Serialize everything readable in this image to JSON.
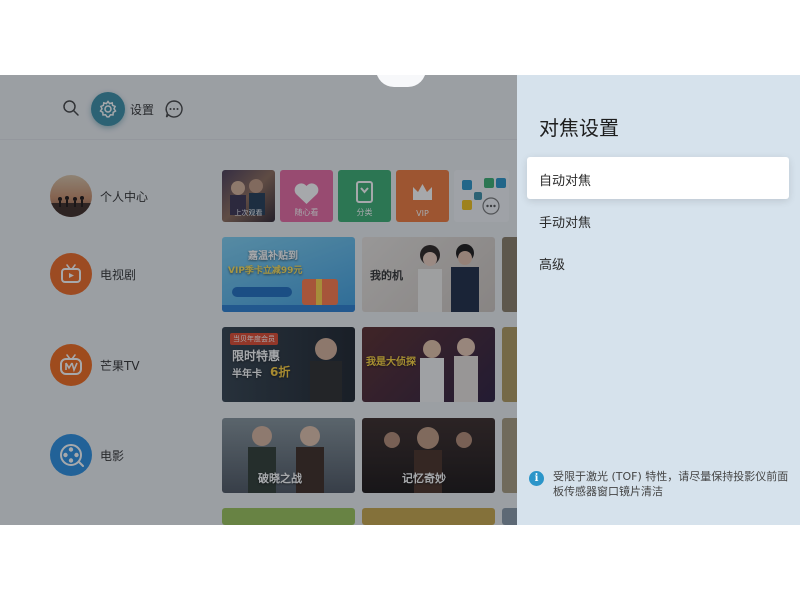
{
  "topbar": {
    "settings_label": "设置",
    "icons": [
      "search-icon",
      "gear-icon",
      "chat-icon"
    ]
  },
  "handle": {
    "chevron": "⌃"
  },
  "sidebar": {
    "items": [
      {
        "label": "个人中心",
        "icon": "avatar"
      },
      {
        "label": "电视剧",
        "icon": "tv-icon",
        "color": "#ef6a23"
      },
      {
        "label": "芒果TV",
        "icon": "mango-tv-icon",
        "color": "#f26a1b"
      },
      {
        "label": "电影",
        "icon": "film-reel-icon",
        "color": "#2a8fe0"
      }
    ]
  },
  "tiles": {
    "row1": [
      {
        "label": "上次观看"
      },
      {
        "label": "随心看"
      },
      {
        "label": "分类"
      },
      {
        "label": "VIP"
      }
    ],
    "promo": {
      "line1": "嘉温补贴到",
      "line2": "VIP季卡立减99元"
    },
    "poster2": {
      "text": "我的机"
    },
    "poster3": {
      "badge": "当贝年度会员",
      "line1": "限时特惠",
      "line2": "半年卡",
      "price": "6折"
    },
    "poster4": {
      "text": "我是大侦探"
    },
    "poster5": {
      "text": "破晓之战"
    },
    "poster6": {
      "text": "记忆奇妙"
    }
  },
  "panel": {
    "title": "对焦设置",
    "items": [
      {
        "label": "自动对焦",
        "selected": true
      },
      {
        "label": "手动对焦",
        "selected": false
      },
      {
        "label": "高级",
        "selected": false
      }
    ],
    "info_icon": "i",
    "info_text": "受限于激光 (TOF) 特性，请尽量保持投影仪前面板传感器窗口镜片清洁"
  },
  "colors": {
    "accent": "#3b8fa6",
    "panel_bg": "#d6e2ec",
    "info": "#2b95c9"
  }
}
